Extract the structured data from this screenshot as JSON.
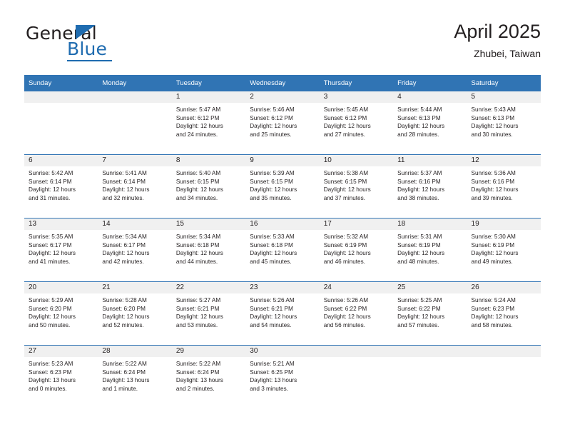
{
  "logo": {
    "word_one": "General",
    "word_two": "Blue",
    "triangle_icon": "blue-triangle-icon"
  },
  "header": {
    "title": "April 2025",
    "location": "Zhubei, Taiwan"
  },
  "calendar": {
    "weekdays": [
      "Sunday",
      "Monday",
      "Tuesday",
      "Wednesday",
      "Thursday",
      "Friday",
      "Saturday"
    ],
    "accent_color": "#3074b4",
    "daynum_band_color": "#f0f0f0",
    "weeks": [
      [
        {
          "day": ""
        },
        {
          "day": ""
        },
        {
          "day": "1",
          "sunrise": "Sunrise: 5:47 AM",
          "sunset": "Sunset: 6:12 PM",
          "daylight_1": "Daylight: 12 hours",
          "daylight_2": "and 24 minutes."
        },
        {
          "day": "2",
          "sunrise": "Sunrise: 5:46 AM",
          "sunset": "Sunset: 6:12 PM",
          "daylight_1": "Daylight: 12 hours",
          "daylight_2": "and 25 minutes."
        },
        {
          "day": "3",
          "sunrise": "Sunrise: 5:45 AM",
          "sunset": "Sunset: 6:12 PM",
          "daylight_1": "Daylight: 12 hours",
          "daylight_2": "and 27 minutes."
        },
        {
          "day": "4",
          "sunrise": "Sunrise: 5:44 AM",
          "sunset": "Sunset: 6:13 PM",
          "daylight_1": "Daylight: 12 hours",
          "daylight_2": "and 28 minutes."
        },
        {
          "day": "5",
          "sunrise": "Sunrise: 5:43 AM",
          "sunset": "Sunset: 6:13 PM",
          "daylight_1": "Daylight: 12 hours",
          "daylight_2": "and 30 minutes."
        }
      ],
      [
        {
          "day": "6",
          "sunrise": "Sunrise: 5:42 AM",
          "sunset": "Sunset: 6:14 PM",
          "daylight_1": "Daylight: 12 hours",
          "daylight_2": "and 31 minutes."
        },
        {
          "day": "7",
          "sunrise": "Sunrise: 5:41 AM",
          "sunset": "Sunset: 6:14 PM",
          "daylight_1": "Daylight: 12 hours",
          "daylight_2": "and 32 minutes."
        },
        {
          "day": "8",
          "sunrise": "Sunrise: 5:40 AM",
          "sunset": "Sunset: 6:15 PM",
          "daylight_1": "Daylight: 12 hours",
          "daylight_2": "and 34 minutes."
        },
        {
          "day": "9",
          "sunrise": "Sunrise: 5:39 AM",
          "sunset": "Sunset: 6:15 PM",
          "daylight_1": "Daylight: 12 hours",
          "daylight_2": "and 35 minutes."
        },
        {
          "day": "10",
          "sunrise": "Sunrise: 5:38 AM",
          "sunset": "Sunset: 6:15 PM",
          "daylight_1": "Daylight: 12 hours",
          "daylight_2": "and 37 minutes."
        },
        {
          "day": "11",
          "sunrise": "Sunrise: 5:37 AM",
          "sunset": "Sunset: 6:16 PM",
          "daylight_1": "Daylight: 12 hours",
          "daylight_2": "and 38 minutes."
        },
        {
          "day": "12",
          "sunrise": "Sunrise: 5:36 AM",
          "sunset": "Sunset: 6:16 PM",
          "daylight_1": "Daylight: 12 hours",
          "daylight_2": "and 39 minutes."
        }
      ],
      [
        {
          "day": "13",
          "sunrise": "Sunrise: 5:35 AM",
          "sunset": "Sunset: 6:17 PM",
          "daylight_1": "Daylight: 12 hours",
          "daylight_2": "and 41 minutes."
        },
        {
          "day": "14",
          "sunrise": "Sunrise: 5:34 AM",
          "sunset": "Sunset: 6:17 PM",
          "daylight_1": "Daylight: 12 hours",
          "daylight_2": "and 42 minutes."
        },
        {
          "day": "15",
          "sunrise": "Sunrise: 5:34 AM",
          "sunset": "Sunset: 6:18 PM",
          "daylight_1": "Daylight: 12 hours",
          "daylight_2": "and 44 minutes."
        },
        {
          "day": "16",
          "sunrise": "Sunrise: 5:33 AM",
          "sunset": "Sunset: 6:18 PM",
          "daylight_1": "Daylight: 12 hours",
          "daylight_2": "and 45 minutes."
        },
        {
          "day": "17",
          "sunrise": "Sunrise: 5:32 AM",
          "sunset": "Sunset: 6:19 PM",
          "daylight_1": "Daylight: 12 hours",
          "daylight_2": "and 46 minutes."
        },
        {
          "day": "18",
          "sunrise": "Sunrise: 5:31 AM",
          "sunset": "Sunset: 6:19 PM",
          "daylight_1": "Daylight: 12 hours",
          "daylight_2": "and 48 minutes."
        },
        {
          "day": "19",
          "sunrise": "Sunrise: 5:30 AM",
          "sunset": "Sunset: 6:19 PM",
          "daylight_1": "Daylight: 12 hours",
          "daylight_2": "and 49 minutes."
        }
      ],
      [
        {
          "day": "20",
          "sunrise": "Sunrise: 5:29 AM",
          "sunset": "Sunset: 6:20 PM",
          "daylight_1": "Daylight: 12 hours",
          "daylight_2": "and 50 minutes."
        },
        {
          "day": "21",
          "sunrise": "Sunrise: 5:28 AM",
          "sunset": "Sunset: 6:20 PM",
          "daylight_1": "Daylight: 12 hours",
          "daylight_2": "and 52 minutes."
        },
        {
          "day": "22",
          "sunrise": "Sunrise: 5:27 AM",
          "sunset": "Sunset: 6:21 PM",
          "daylight_1": "Daylight: 12 hours",
          "daylight_2": "and 53 minutes."
        },
        {
          "day": "23",
          "sunrise": "Sunrise: 5:26 AM",
          "sunset": "Sunset: 6:21 PM",
          "daylight_1": "Daylight: 12 hours",
          "daylight_2": "and 54 minutes."
        },
        {
          "day": "24",
          "sunrise": "Sunrise: 5:26 AM",
          "sunset": "Sunset: 6:22 PM",
          "daylight_1": "Daylight: 12 hours",
          "daylight_2": "and 56 minutes."
        },
        {
          "day": "25",
          "sunrise": "Sunrise: 5:25 AM",
          "sunset": "Sunset: 6:22 PM",
          "daylight_1": "Daylight: 12 hours",
          "daylight_2": "and 57 minutes."
        },
        {
          "day": "26",
          "sunrise": "Sunrise: 5:24 AM",
          "sunset": "Sunset: 6:23 PM",
          "daylight_1": "Daylight: 12 hours",
          "daylight_2": "and 58 minutes."
        }
      ],
      [
        {
          "day": "27",
          "sunrise": "Sunrise: 5:23 AM",
          "sunset": "Sunset: 6:23 PM",
          "daylight_1": "Daylight: 13 hours",
          "daylight_2": "and 0 minutes."
        },
        {
          "day": "28",
          "sunrise": "Sunrise: 5:22 AM",
          "sunset": "Sunset: 6:24 PM",
          "daylight_1": "Daylight: 13 hours",
          "daylight_2": "and 1 minute."
        },
        {
          "day": "29",
          "sunrise": "Sunrise: 5:22 AM",
          "sunset": "Sunset: 6:24 PM",
          "daylight_1": "Daylight: 13 hours",
          "daylight_2": "and 2 minutes."
        },
        {
          "day": "30",
          "sunrise": "Sunrise: 5:21 AM",
          "sunset": "Sunset: 6:25 PM",
          "daylight_1": "Daylight: 13 hours",
          "daylight_2": "and 3 minutes."
        },
        {
          "day": ""
        },
        {
          "day": ""
        },
        {
          "day": ""
        }
      ]
    ]
  }
}
